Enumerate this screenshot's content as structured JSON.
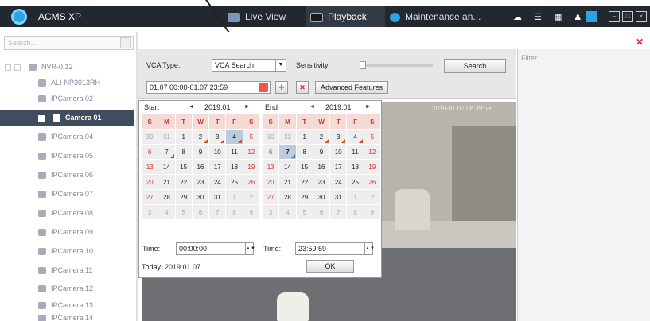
{
  "app": {
    "title": "ACMS XP"
  },
  "tabs": [
    {
      "label": "Live View"
    },
    {
      "label": "Playback"
    },
    {
      "label": "Maintenance an..."
    }
  ],
  "left": {
    "search_placeholder": "Search...",
    "nvr": "NVR-0.12",
    "items": [
      "ALI-NP3013RH",
      "IPCamera 02",
      "Camera 01",
      "IPCamera 04",
      "IPCamera 05",
      "IPCamera 06",
      "IPCamera 07",
      "IPCamera 08",
      "IPCamera 09",
      "IPCamera 10",
      "IPCamera 11",
      "IPCamera 12",
      "IPCamera 13",
      "IPCamera 14"
    ]
  },
  "toolbar": {
    "vca_type_label": "VCA Type:",
    "vca_type_value": "VCA Search",
    "sensitivity_label": "Sensitivity:",
    "search_button": "Search",
    "date_range": "01.07 00:00-01.07 23:59",
    "advanced_button": "Advanced Features"
  },
  "filter": {
    "label": "Filter"
  },
  "video": {
    "timestamp": "2019-01-07 08:39:59"
  },
  "calendar": {
    "start_label": "Start",
    "end_label": "End",
    "month": "2019.01",
    "weekdays": [
      "S",
      "M",
      "T",
      "W",
      "T",
      "F",
      "S"
    ],
    "rows": [
      [
        "30",
        "31",
        "1",
        "2",
        "3",
        "4",
        "5"
      ],
      [
        "6",
        "7",
        "8",
        "9",
        "10",
        "11",
        "12"
      ],
      [
        "13",
        "14",
        "15",
        "16",
        "17",
        "18",
        "19"
      ],
      [
        "20",
        "21",
        "22",
        "23",
        "24",
        "25",
        "26"
      ],
      [
        "27",
        "28",
        "29",
        "30",
        "31",
        "1",
        "2"
      ],
      [
        "3",
        "4",
        "5",
        "6",
        "7",
        "8",
        "9"
      ]
    ],
    "time_label": "Time:",
    "start_time": "00:00:00",
    "end_time": "23:59:59",
    "today": "Today: 2019.01.07",
    "ok": "OK",
    "prev_arrow": "◄",
    "next_arrow": "►"
  },
  "colors": {
    "titlebar": "#23282f",
    "selected": "#3f4d5e",
    "accent": "#2da3e0"
  }
}
